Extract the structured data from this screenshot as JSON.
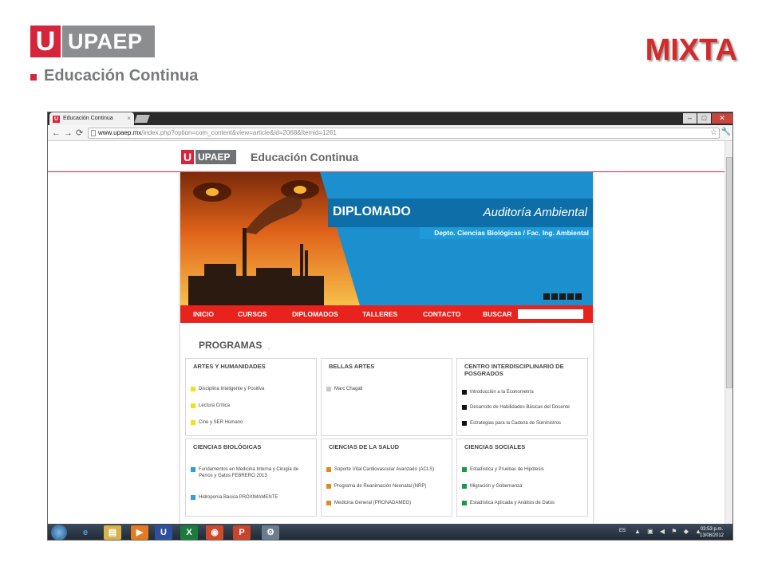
{
  "slide": {
    "logo_letter": "U",
    "logo_name": "UPAEP",
    "logo_sub": "Educación Continua",
    "title": "MIXTA"
  },
  "browser": {
    "tab_title": "Educación Continua",
    "tab_close": "×",
    "url_domain": "www.upaep.mx",
    "url_path": "/index.php?option=com_content&view=article&id=2068&Itemid=1261"
  },
  "site": {
    "logo_letter": "U",
    "logo_name": "UPAEP",
    "subtitle": "Educación Continua"
  },
  "banner": {
    "label": "DIPLOMADO",
    "title": "Auditoría Ambiental",
    "department": "Depto. Ciencias Biológicas / Fac. Ing. Ambiental"
  },
  "menu": {
    "items": [
      "INICIO",
      "CURSOS",
      "DIPLOMADOS",
      "TALLERES",
      "CONTACTO"
    ],
    "search_label": "BUSCAR"
  },
  "programs": {
    "heading": "PROGRAMAS",
    "cards": [
      {
        "title": "ARTES Y HUMANIDADES",
        "color": "#f2e01a",
        "items": [
          "Disciplina Inteligente y Positiva",
          "Lectura Crítica",
          "Cine y SER Humano"
        ]
      },
      {
        "title": "BELLAS ARTES",
        "color": "#c8c8c8",
        "items": [
          "Marc Chagall"
        ]
      },
      {
        "title": "CENTRO INTERDISCIPLINARIO DE POSGRADOS",
        "color": "#111111",
        "items": [
          "Introducción a la Econometría",
          "Desarrollo de Habilidades Básicas del Docente",
          "Estrategias para la Cadena de Suministros"
        ]
      },
      {
        "title": "CIENCIAS BIOLÓGICAS",
        "color": "#2e9fd8",
        "items": [
          "Fundamentos en Medicina Interna y Cirugía de Perros y Gatos FEBRERO 2013",
          "Hidroponía Básica PRÓXIMAMENTE"
        ]
      },
      {
        "title": "CIENCIAS DE LA SALUD",
        "color": "#e08a22",
        "items": [
          "Soporte Vital Cardiovascular Avanzado (ACLS)",
          "Programa de Reanimación Neonatal (NRP)",
          "Medicina General (PRONADAMEG)"
        ]
      },
      {
        "title": "CIENCIAS SOCIALES",
        "color": "#179b4b",
        "items": [
          "Estadística y Pruebas de Hipótesis",
          "Migración y Gobernanza",
          "Estadística Aplicada y Análisis de Datos"
        ]
      }
    ]
  },
  "taskbar": {
    "lang": "ES",
    "time": "03:53 p.m.",
    "date": "13/08/2012"
  },
  "colors": {
    "brand_red": "#d6243a",
    "menu_red": "#e8231e",
    "banner_blue": "#1c8fcf"
  }
}
